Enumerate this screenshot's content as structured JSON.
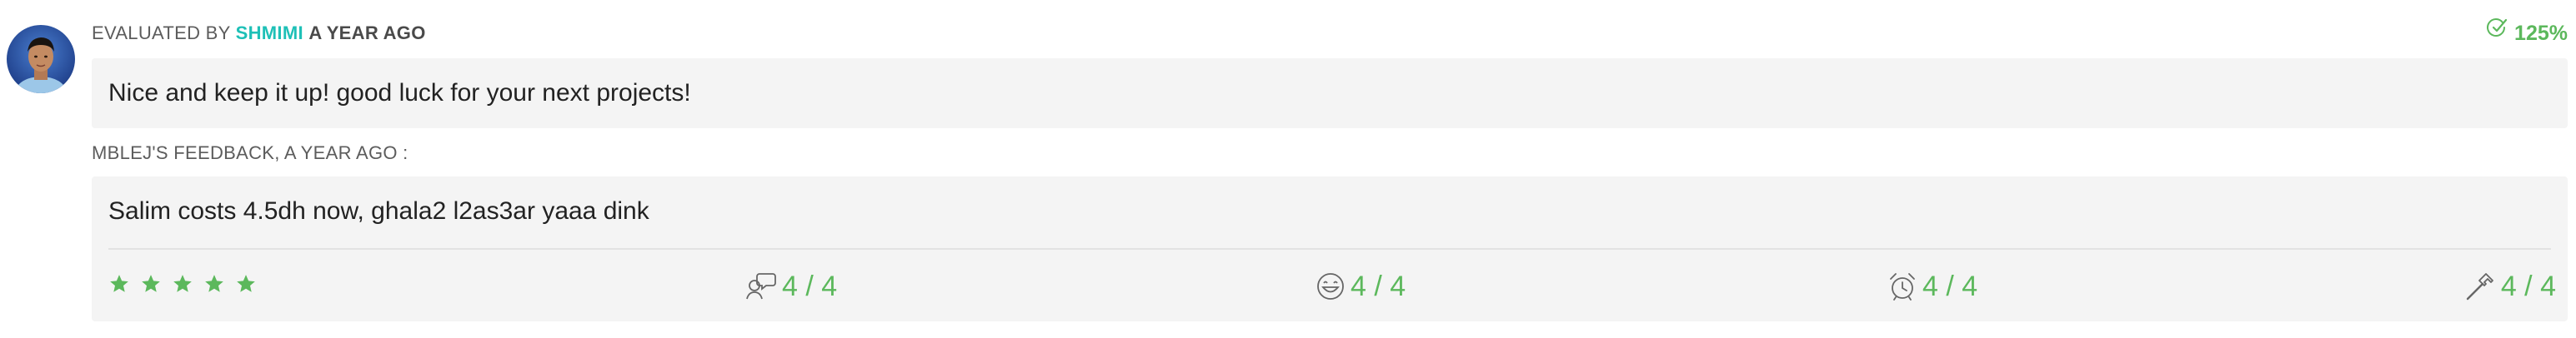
{
  "evaluation": {
    "evaluated_by_prefix": "EVALUATED BY",
    "evaluator_name": "SHMIMI",
    "time_ago": "A YEAR AGO",
    "score": "125%",
    "comment": "Nice and keep it up! good luck for your next projects!"
  },
  "feedback": {
    "label": "MBLEJ'S FEEDBACK, A YEAR AGO :",
    "comment": "Salim costs 4.5dh now, ghala2 l2as3ar yaaa dink",
    "stars": 5,
    "ratings": [
      {
        "icon": "speech-bubble-icon",
        "value": "4 / 4"
      },
      {
        "icon": "smiley-face-icon",
        "value": "4 / 4"
      },
      {
        "icon": "alarm-clock-icon",
        "value": "4 / 4"
      },
      {
        "icon": "hammer-icon",
        "value": "4 / 4"
      }
    ]
  },
  "colors": {
    "accent_teal": "#1ec0b7",
    "accent_green": "#5cb85c",
    "box_background": "#f4f4f4"
  }
}
